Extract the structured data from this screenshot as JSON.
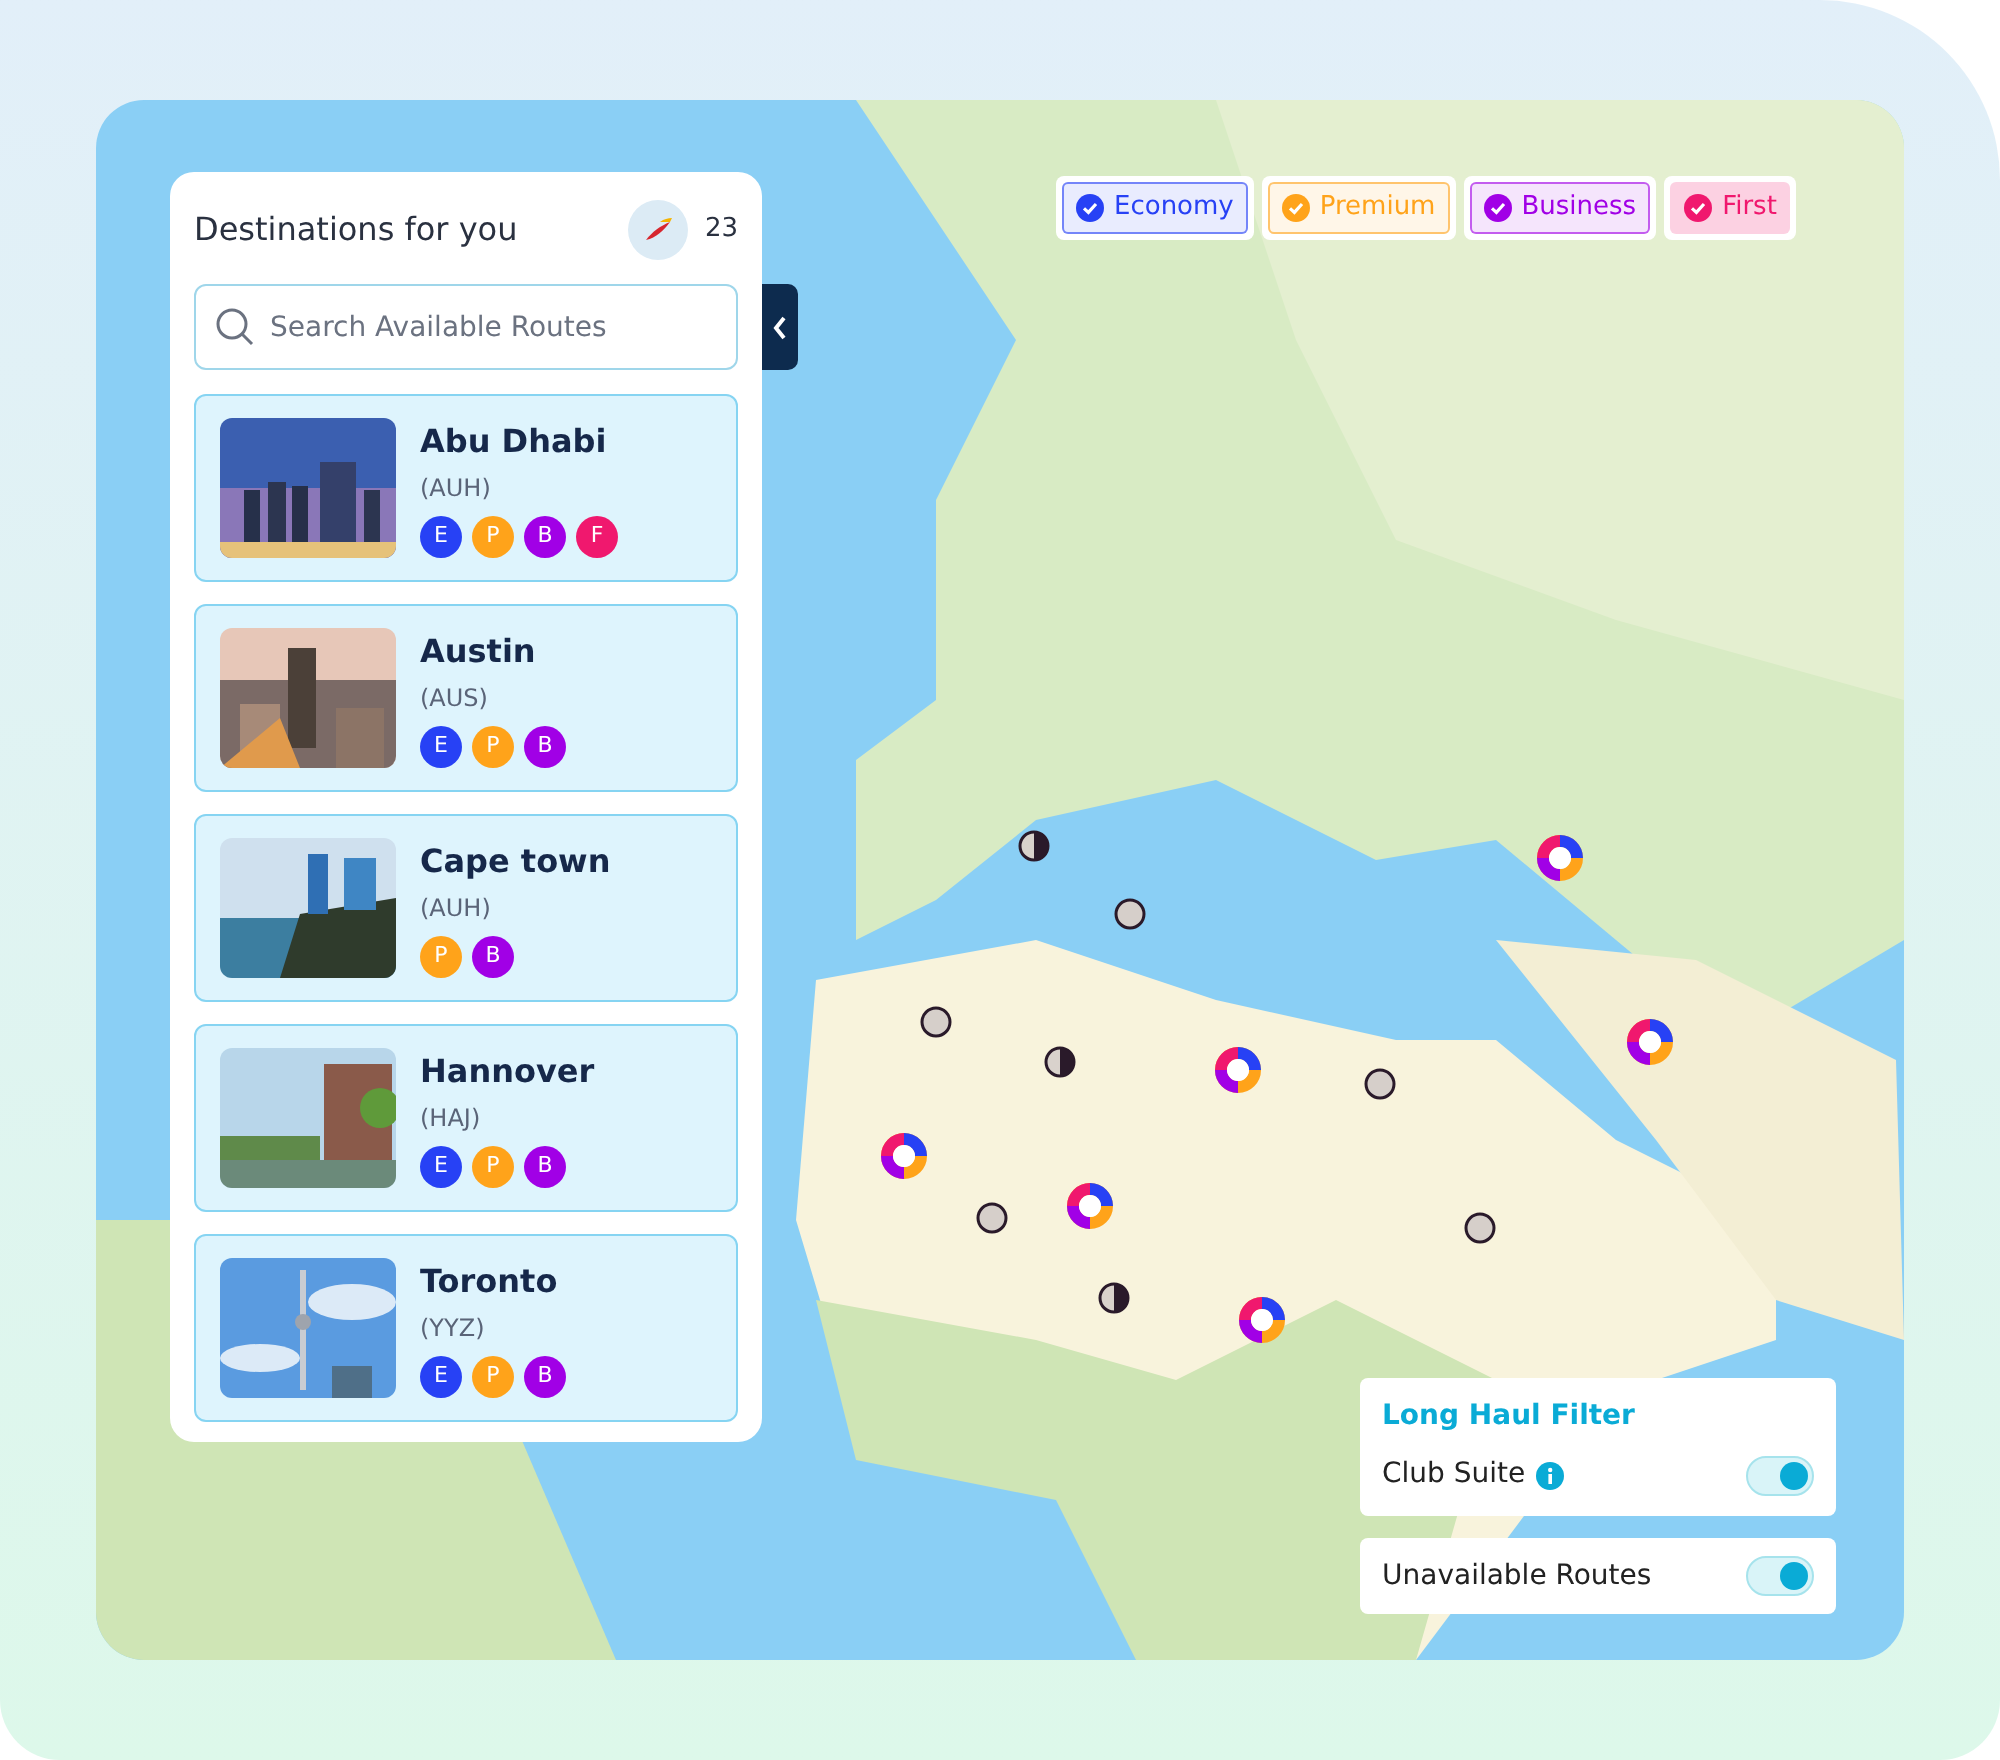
{
  "panel": {
    "title": "Destinations for you",
    "count": "23",
    "search": {
      "placeholder": "Search Available Routes"
    },
    "destinations": [
      {
        "name": "Abu Dhabi",
        "code": "(AUH)",
        "classes": [
          {
            "letter": "E",
            "color": "#2741f5"
          },
          {
            "letter": "P",
            "color": "#ffa31a"
          },
          {
            "letter": "B",
            "color": "#a100e6"
          },
          {
            "letter": "F",
            "color": "#f0186e"
          }
        ]
      },
      {
        "name": "Austin",
        "code": "(AUS)",
        "classes": [
          {
            "letter": "E",
            "color": "#2741f5"
          },
          {
            "letter": "P",
            "color": "#ffa31a"
          },
          {
            "letter": "B",
            "color": "#a100e6"
          }
        ]
      },
      {
        "name": "Cape town",
        "code": "(AUH)",
        "classes": [
          {
            "letter": "P",
            "color": "#ffa31a"
          },
          {
            "letter": "B",
            "color": "#a100e6"
          }
        ]
      },
      {
        "name": "Hannover",
        "code": "(HAJ)",
        "classes": [
          {
            "letter": "E",
            "color": "#2741f5"
          },
          {
            "letter": "P",
            "color": "#ffa31a"
          },
          {
            "letter": "B",
            "color": "#a100e6"
          }
        ]
      },
      {
        "name": "Toronto",
        "code": "(YYZ)",
        "classes": [
          {
            "letter": "E",
            "color": "#2741f5"
          },
          {
            "letter": "P",
            "color": "#ffa31a"
          },
          {
            "letter": "B",
            "color": "#a100e6"
          }
        ]
      }
    ]
  },
  "cabin_filters": [
    {
      "label": "Economy",
      "color": "#2741f5",
      "checked": true
    },
    {
      "label": "Premium",
      "color": "#ffa31a",
      "checked": true
    },
    {
      "label": "Business",
      "color": "#a100e6",
      "checked": true
    },
    {
      "label": "First",
      "color": "#f0186e",
      "checked": true
    }
  ],
  "markers": [
    {
      "kind": "half"
    },
    {
      "kind": "empty"
    },
    {
      "kind": "empty"
    },
    {
      "kind": "half"
    },
    {
      "kind": "donut"
    },
    {
      "kind": "empty"
    },
    {
      "kind": "donut"
    },
    {
      "kind": "donut"
    },
    {
      "kind": "donut"
    },
    {
      "kind": "empty"
    },
    {
      "kind": "donut"
    },
    {
      "kind": "half"
    },
    {
      "kind": "donut"
    },
    {
      "kind": "empty"
    }
  ],
  "long_haul": {
    "title": "Long Haul Filter",
    "toggles": [
      {
        "label": "Club Suite",
        "info": true,
        "on": true
      }
    ]
  },
  "unavailable_routes": {
    "label": "Unavailable Routes",
    "on": true
  }
}
